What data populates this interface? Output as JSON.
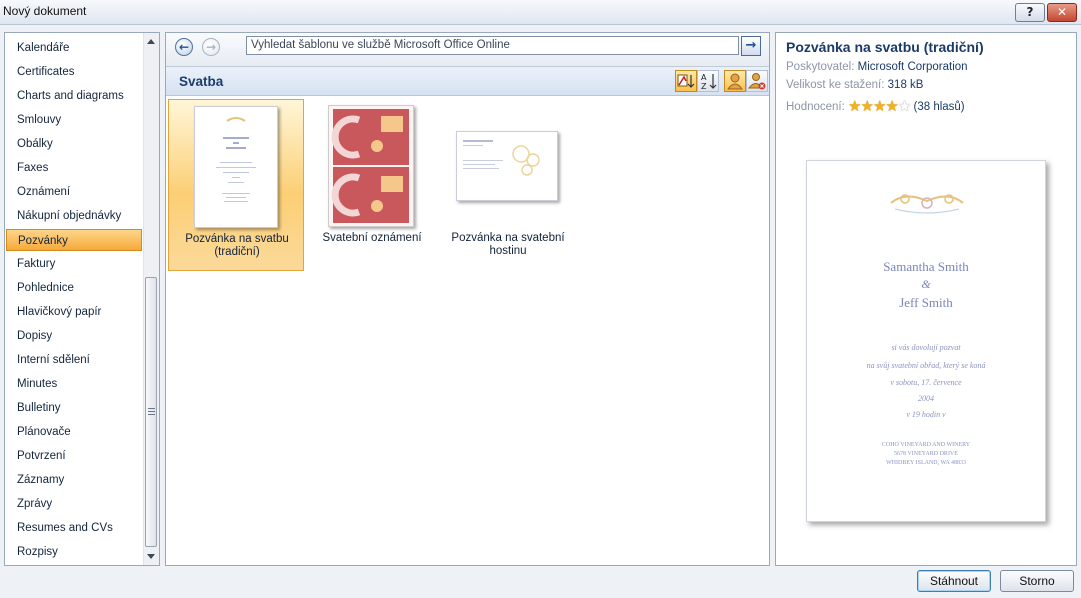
{
  "window": {
    "title": "Nový dokument",
    "help_label": "?",
    "close_label": "✕"
  },
  "categories": [
    "Kalendáře",
    "Certificates",
    "Charts and diagrams",
    "Smlouvy",
    "Obálky",
    "Faxes",
    "Oznámení",
    "Nákupní objednávky",
    "Pozvánky",
    "Faktury",
    "Pohlednice",
    "Hlavičkový papír",
    "Dopisy",
    "Interní sdělení",
    "Minutes",
    "Bulletiny",
    "Plánovače",
    "Potvrzení",
    "Záznamy",
    "Zprávy",
    "Resumes and CVs",
    "Rozpisy"
  ],
  "selected_category": "Pozvánky",
  "navigation": {
    "back_label": "←",
    "forward_label": "→",
    "search_value": "Vyhledat šablonu ve službě Microsoft Office Online",
    "go_label": "→"
  },
  "section": {
    "title": "Svatba"
  },
  "templates": [
    {
      "label_line1": "Pozvánka na svatbu",
      "label_line2": "(tradiční)"
    },
    {
      "label_line1": "Svatební oznámení",
      "label_line2": ""
    },
    {
      "label_line1": "Pozvánka na svatební",
      "label_line2": "hostinu"
    }
  ],
  "details": {
    "title": "Pozvánka na svatbu (tradiční)",
    "provider_label": "Poskytovatel:",
    "provider_value": "Microsoft Corporation",
    "size_label": "Velikost ke stažení:",
    "size_value": "318 kB",
    "rating_label": "Hodnocení:",
    "rating_stars_filled": 4,
    "rating_stars_total": 5,
    "rating_votes": "(38 hlasů)"
  },
  "preview": {
    "name1": "Samantha Smith",
    "amp": "&",
    "name2": "Jeff Smith",
    "line1": "si vás dovolují pozvat",
    "line2": "na svůj svatební obřad, který se koná",
    "line3": "v sobotu, 17. července",
    "line4": "2004",
    "line5": "v 19 hodin v",
    "addr1": "COHO VINEYARD AND WINERY",
    "addr2": "5678 VINEYARD DRIVE",
    "addr3": "WHIDBEY ISLAND, WA 48833"
  },
  "buttons": {
    "download": "Stáhnout",
    "cancel": "Storno"
  },
  "colors": {
    "accent": "#1b3a6a",
    "selection": "#f6a93a",
    "star": "#f1b21a"
  }
}
